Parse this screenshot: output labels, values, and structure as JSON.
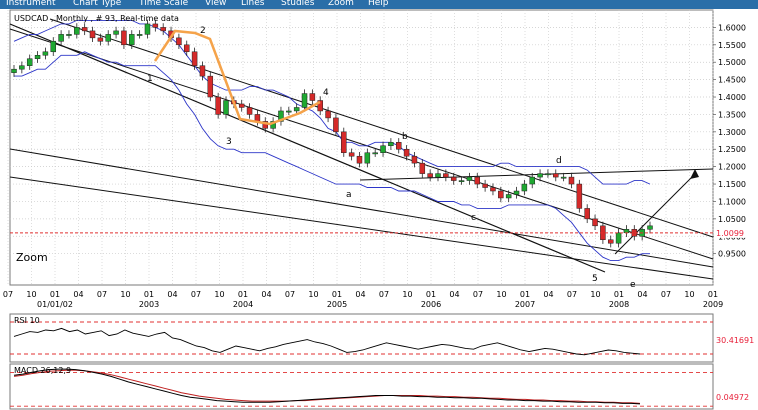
{
  "menu": [
    "Instrument",
    "Chart Type",
    "Time Scale",
    "View",
    "Lines",
    "Studies",
    "Zoom",
    "Help"
  ],
  "chart_data": [
    {
      "type": "candlestick",
      "title": "USDCAD , Monthly , # 93, Real-time data",
      "ylim": [
        0.86,
        1.65
      ],
      "y_ticks": [
        "1.6000",
        "1.5500",
        "1.5000",
        "1.4500",
        "1.4000",
        "1.3500",
        "1.3000",
        "1.2500",
        "1.2000",
        "1.1500",
        "1.1000",
        "1.0500",
        "1.0000",
        "0.9500"
      ],
      "y_tick_values": [
        1.6,
        1.55,
        1.5,
        1.45,
        1.4,
        1.35,
        1.3,
        1.25,
        1.2,
        1.15,
        1.1,
        1.05,
        1.0,
        0.95
      ],
      "last_price": "1.0099",
      "last_price_value": 1.0099,
      "zoom_label": "Zoom",
      "x_months": [
        "07",
        "10",
        "01",
        "04",
        "07",
        "10",
        "01",
        "04",
        "07",
        "10",
        "01",
        "04",
        "07",
        "10",
        "01",
        "04",
        "07",
        "10",
        "01",
        "04",
        "07",
        "10",
        "01",
        "04",
        "07",
        "10",
        "01",
        "04",
        "07",
        "10",
        "01"
      ],
      "x_years": [
        {
          "label": "01/01/02",
          "index": 2
        },
        {
          "label": "2003",
          "index": 6
        },
        {
          "label": "2004",
          "index": 10
        },
        {
          "label": "2005",
          "index": 14
        },
        {
          "label": "2006",
          "index": 18
        },
        {
          "label": "2007",
          "index": 22
        },
        {
          "label": "2008",
          "index": 26
        },
        {
          "label": "2009",
          "index": 30
        }
      ],
      "wave_labels": [
        "1",
        "2",
        "3",
        "4",
        "5",
        "a",
        "b",
        "c",
        "d",
        "e"
      ],
      "close": [
        1.48,
        1.49,
        1.51,
        1.52,
        1.53,
        1.56,
        1.58,
        1.58,
        1.6,
        1.59,
        1.57,
        1.56,
        1.58,
        1.59,
        1.55,
        1.58,
        1.58,
        1.61,
        1.6,
        1.59,
        1.57,
        1.55,
        1.53,
        1.49,
        1.46,
        1.4,
        1.35,
        1.39,
        1.38,
        1.37,
        1.35,
        1.33,
        1.31,
        1.33,
        1.36,
        1.36,
        1.37,
        1.41,
        1.39,
        1.36,
        1.34,
        1.3,
        1.24,
        1.23,
        1.21,
        1.24,
        1.24,
        1.26,
        1.27,
        1.25,
        1.23,
        1.21,
        1.18,
        1.17,
        1.18,
        1.17,
        1.16,
        1.16,
        1.17,
        1.15,
        1.14,
        1.13,
        1.11,
        1.12,
        1.13,
        1.15,
        1.17,
        1.18,
        1.18,
        1.17,
        1.17,
        1.15,
        1.08,
        1.05,
        1.03,
        0.99,
        0.98,
        1.01,
        1.02,
        1.0,
        1.02,
        1.03
      ],
      "upper_band": [
        1.56,
        1.57,
        1.58,
        1.58,
        1.59,
        1.6,
        1.61,
        1.61,
        1.62,
        1.62,
        1.62,
        1.62,
        1.62,
        1.62,
        1.62,
        1.62,
        1.61,
        1.61,
        1.6,
        1.59,
        1.57,
        1.55,
        1.52,
        1.49,
        1.46,
        1.44,
        1.43,
        1.42,
        1.42,
        1.42,
        1.43,
        1.43,
        1.42,
        1.42,
        1.41,
        1.4,
        1.38,
        1.37,
        1.36,
        1.34,
        1.31,
        1.3,
        1.27,
        1.27,
        1.26,
        1.26,
        1.27,
        1.27,
        1.27,
        1.26,
        1.24,
        1.23,
        1.22,
        1.21,
        1.2,
        1.2,
        1.2,
        1.2,
        1.2,
        1.2,
        1.2,
        1.2,
        1.21,
        1.21,
        1.2,
        1.2,
        1.2,
        1.2,
        1.2,
        1.2,
        1.2,
        1.2,
        1.2,
        1.19,
        1.17,
        1.15,
        1.15,
        1.15,
        1.15,
        1.16,
        1.16,
        1.15
      ],
      "lower_band": [
        1.46,
        1.46,
        1.47,
        1.48,
        1.48,
        1.5,
        1.52,
        1.52,
        1.52,
        1.53,
        1.52,
        1.51,
        1.5,
        1.5,
        1.49,
        1.49,
        1.49,
        1.49,
        1.49,
        1.47,
        1.45,
        1.42,
        1.38,
        1.35,
        1.31,
        1.28,
        1.26,
        1.25,
        1.25,
        1.24,
        1.24,
        1.24,
        1.24,
        1.23,
        1.22,
        1.21,
        1.2,
        1.19,
        1.18,
        1.17,
        1.16,
        1.15,
        1.15,
        1.15,
        1.15,
        1.14,
        1.14,
        1.14,
        1.14,
        1.13,
        1.13,
        1.13,
        1.12,
        1.11,
        1.1,
        1.1,
        1.1,
        1.09,
        1.09,
        1.08,
        1.08,
        1.08,
        1.08,
        1.09,
        1.09,
        1.09,
        1.09,
        1.09,
        1.09,
        1.08,
        1.06,
        1.04,
        1.01,
        0.98,
        0.96,
        0.94,
        0.93,
        0.93,
        0.94,
        0.94,
        0.95,
        0.95
      ]
    },
    {
      "type": "line",
      "title": "RSI 10",
      "last_value_label": "30.41691",
      "ylim": [
        20,
        80
      ],
      "levels": [
        70,
        30
      ],
      "values": [
        52,
        55,
        58,
        57,
        60,
        59,
        62,
        58,
        60,
        55,
        57,
        59,
        53,
        55,
        60,
        56,
        54,
        52,
        55,
        57,
        50,
        48,
        44,
        40,
        38,
        34,
        32,
        36,
        40,
        38,
        36,
        34,
        37,
        39,
        42,
        44,
        46,
        48,
        45,
        43,
        40,
        36,
        32,
        33,
        35,
        38,
        41,
        44,
        42,
        40,
        38,
        36,
        38,
        40,
        42,
        41,
        39,
        37,
        36,
        40,
        42,
        44,
        41,
        38,
        35,
        33,
        35,
        37,
        36,
        34,
        32,
        30,
        29,
        31,
        33,
        35,
        34,
        32,
        31,
        30
      ]
    },
    {
      "type": "line",
      "title": "MACD 26,12,9",
      "last_value_label": "0.04972",
      "ylim": [
        -0.04,
        0.04
      ],
      "levels": [
        0.025,
        -0.035
      ],
      "macd": [
        0.02,
        0.022,
        0.025,
        0.028,
        0.03,
        0.031,
        0.031,
        0.03,
        0.028,
        0.025,
        0.022,
        0.018,
        0.013,
        0.008,
        0.004,
        0.0,
        -0.004,
        -0.008,
        -0.012,
        -0.016,
        -0.019,
        -0.021,
        -0.023,
        -0.025,
        -0.026,
        -0.027,
        -0.028,
        -0.028,
        -0.028,
        -0.028,
        -0.027,
        -0.026,
        -0.025,
        -0.024,
        -0.023,
        -0.022,
        -0.021,
        -0.02,
        -0.019,
        -0.018,
        -0.017,
        -0.016,
        -0.016,
        -0.016,
        -0.017,
        -0.017,
        -0.018,
        -0.018,
        -0.019,
        -0.019,
        -0.02,
        -0.02,
        -0.021,
        -0.021,
        -0.022,
        -0.023,
        -0.024,
        -0.024,
        -0.025,
        -0.025,
        -0.026,
        -0.026,
        -0.027,
        -0.027,
        -0.028,
        -0.028,
        -0.028,
        -0.029,
        -0.029,
        -0.03,
        -0.03,
        -0.031
      ],
      "signal": [
        0.018,
        0.02,
        0.023,
        0.025,
        0.027,
        0.028,
        0.029,
        0.029,
        0.028,
        0.026,
        0.024,
        0.021,
        0.017,
        0.013,
        0.009,
        0.005,
        0.001,
        -0.003,
        -0.007,
        -0.011,
        -0.014,
        -0.017,
        -0.019,
        -0.021,
        -0.023,
        -0.024,
        -0.025,
        -0.026,
        -0.026,
        -0.026,
        -0.026,
        -0.026,
        -0.025,
        -0.025,
        -0.024,
        -0.023,
        -0.022,
        -0.021,
        -0.02,
        -0.019,
        -0.018,
        -0.017,
        -0.016,
        -0.016,
        -0.016,
        -0.016,
        -0.016,
        -0.017,
        -0.017,
        -0.018,
        -0.018,
        -0.019,
        -0.019,
        -0.02,
        -0.021,
        -0.021,
        -0.022,
        -0.023,
        -0.023,
        -0.024,
        -0.024,
        -0.025,
        -0.025,
        -0.026,
        -0.026,
        -0.027,
        -0.027,
        -0.028,
        -0.028,
        -0.029,
        -0.029,
        -0.03
      ]
    }
  ],
  "colors": {
    "menubar": "#2a6ea8",
    "bull": "#1fa832",
    "bear": "#d52a2a",
    "band": "#2c35c8",
    "wave": "#f5a34a",
    "grid": "#c8c8c8",
    "level": "#e03030",
    "price_tag": "#e8213a"
  }
}
